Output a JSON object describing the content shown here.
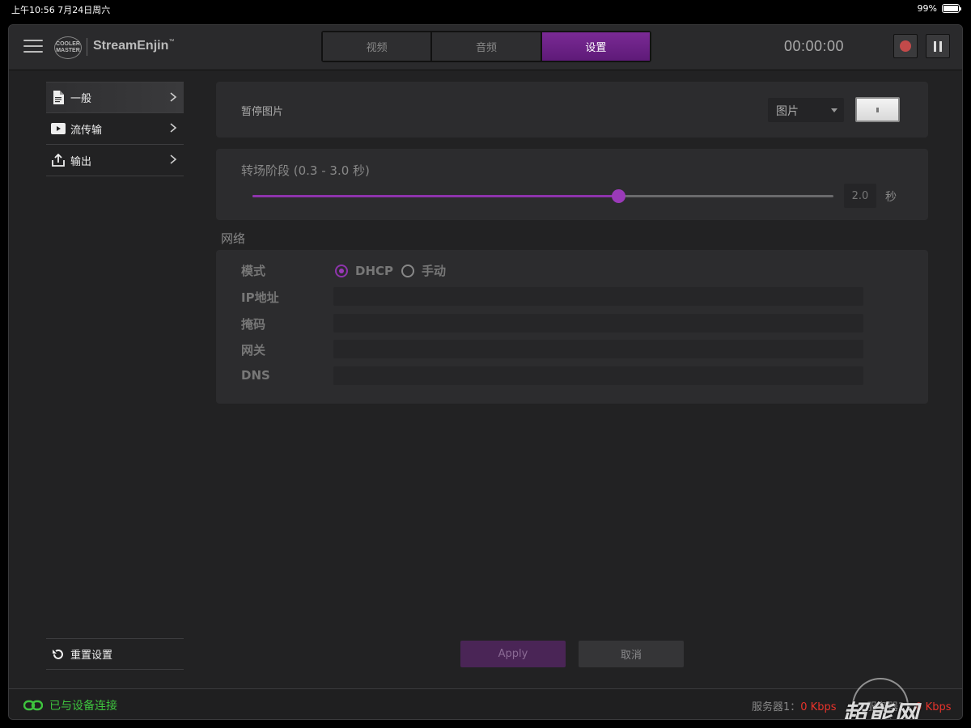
{
  "status_bar": {
    "time": "上午10:56   7月24日周六",
    "battery": "99%",
    "battery_level": 0.99
  },
  "header": {
    "logo_text": "COOLER MASTER",
    "brand": "StreamEnjin",
    "brand_tm": "™",
    "tabs": [
      {
        "label": "视频",
        "active": false
      },
      {
        "label": "音频",
        "active": false
      },
      {
        "label": "设置",
        "active": true
      }
    ],
    "timer": "00:00:00",
    "record_icon": "record-icon",
    "pause_icon": "pause-icon"
  },
  "sidebar": {
    "items": [
      {
        "label": "一般",
        "icon": "document-icon",
        "active": true
      },
      {
        "label": "流传输",
        "icon": "play-icon",
        "active": false
      },
      {
        "label": "输出",
        "icon": "upload-icon",
        "active": false
      }
    ],
    "reset_label": "重置设置"
  },
  "pause_image": {
    "label": "暂停图片",
    "select_value": "图片"
  },
  "transition": {
    "label": "转场阶段 (0.3 - 3.0 秒)",
    "min": 0.3,
    "max": 3.0,
    "value": 2.0,
    "value_display": "2.0",
    "unit": "秒"
  },
  "network": {
    "heading": "网络",
    "mode_label": "模式",
    "mode_options": [
      {
        "label": "DHCP",
        "checked": true
      },
      {
        "label": "手动",
        "checked": false
      }
    ],
    "ip_label": "IP地址",
    "mask_label": "掩码",
    "gateway_label": "网关",
    "dns_label": "DNS",
    "ip_value": "",
    "mask_value": "",
    "gateway_value": "",
    "dns_value": ""
  },
  "actions": {
    "apply_label": "Apply",
    "cancel_label": "取消"
  },
  "footer": {
    "connection_text": "已与设备连接",
    "server1_label": "服务器1：",
    "server1_value": "0 Kbps",
    "server2_label": "服务器2：",
    "server2_value": "0 Kbps",
    "watermark": "超能网"
  },
  "colors": {
    "accent": "#7a2a95",
    "connected": "#3ec43e",
    "bitrate": "#e8332b"
  }
}
